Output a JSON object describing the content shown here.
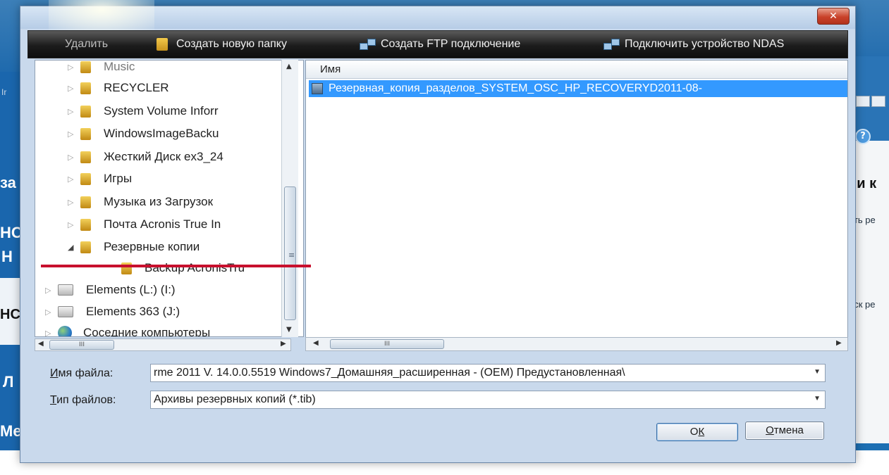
{
  "background_app": {
    "left_labels": [
      "Ir",
      "за",
      "НС",
      "Н",
      "НС",
      "Л",
      "Ме"
    ],
    "right_labels": [
      "ии к",
      "ать ре",
      "иск ре"
    ]
  },
  "dialog": {
    "close_label": "✕",
    "toolbar": {
      "delete_label": "Удалить",
      "new_folder_label": "Создать новую папку",
      "ftp_label": "Создать FTP подключение",
      "ndas_label": "Подключить устройство NDAS"
    },
    "tree": {
      "items": [
        {
          "label": "Music"
        },
        {
          "label": "RECYCLER"
        },
        {
          "label": "System Volume Inforr"
        },
        {
          "label": "WindowsImageBacku"
        },
        {
          "label": "Жесткий Диск ex3_24"
        },
        {
          "label": "Игры"
        },
        {
          "label": "Музыка из Загрузок"
        },
        {
          "label": "Почта Acronis True In"
        },
        {
          "label": "Резервные копии"
        },
        {
          "label": "Backup AcronisTru"
        },
        {
          "label": "Elements (L:) (I:)"
        },
        {
          "label": "Elements 363 (J:)"
        },
        {
          "label": "Соседние компьютеры"
        }
      ]
    },
    "file_list": {
      "column_header": "Имя",
      "rows": [
        {
          "name": "Резервная_копия_разделов_SYSTEM_OSC_HP_RECOVERYD2011-08-"
        }
      ]
    },
    "filename": {
      "label_u": "И",
      "label_rest": "мя файла:",
      "value": "rme 2011 V. 14.0.0.5519 Windows7_Домашняя_расширенная - (OEM) Предустановленная\\"
    },
    "filetype": {
      "label_u": "Т",
      "label_rest": "ип файлов:",
      "value": "Архивы резервных копий (*.tib)"
    },
    "buttons": {
      "ok_label_u": "К",
      "ok_label_pre": "О",
      "cancel_label_u": "О",
      "cancel_label_rest": "тмена"
    }
  }
}
